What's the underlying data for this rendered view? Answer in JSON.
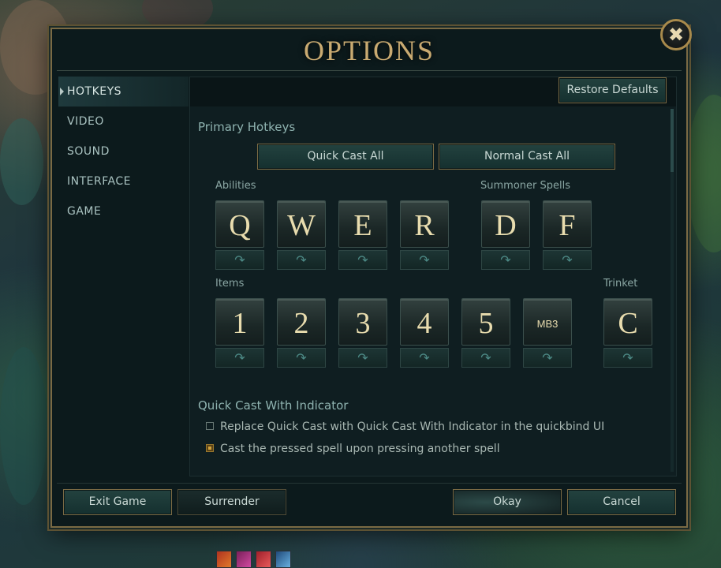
{
  "window": {
    "title": "OPTIONS",
    "close_icon": "✖"
  },
  "sidebar": {
    "items": [
      {
        "label": "HOTKEYS",
        "active": true
      },
      {
        "label": "VIDEO"
      },
      {
        "label": "SOUND"
      },
      {
        "label": "INTERFACE"
      },
      {
        "label": "GAME"
      }
    ]
  },
  "toolbar": {
    "restore_defaults": "Restore Defaults"
  },
  "primary": {
    "heading": "Primary Hotkeys",
    "quick_cast_all": "Quick Cast All",
    "normal_cast_all": "Normal Cast All",
    "abilities_label": "Abilities",
    "summoner_label": "Summoner Spells",
    "items_label": "Items",
    "trinket_label": "Trinket",
    "abilities": [
      "Q",
      "W",
      "E",
      "R"
    ],
    "summoners": [
      "D",
      "F"
    ],
    "items": [
      "1",
      "2",
      "3",
      "4",
      "5",
      "MB3"
    ],
    "trinket": "C",
    "quickbind_icon": "↷"
  },
  "indicator": {
    "heading": "Quick Cast With Indicator",
    "option1": {
      "label": "Replace Quick Cast with Quick Cast With Indicator in the quickbind UI",
      "checked": false
    },
    "option2": {
      "label": "Cast the pressed spell upon pressing another spell",
      "checked": true
    }
  },
  "footer": {
    "exit_game": "Exit Game",
    "surrender": "Surrender",
    "okay": "Okay",
    "cancel": "Cancel"
  },
  "colors": {
    "gold": "#c9aa71",
    "accent": "#d1a23c",
    "teal": "#1f3a3d"
  }
}
